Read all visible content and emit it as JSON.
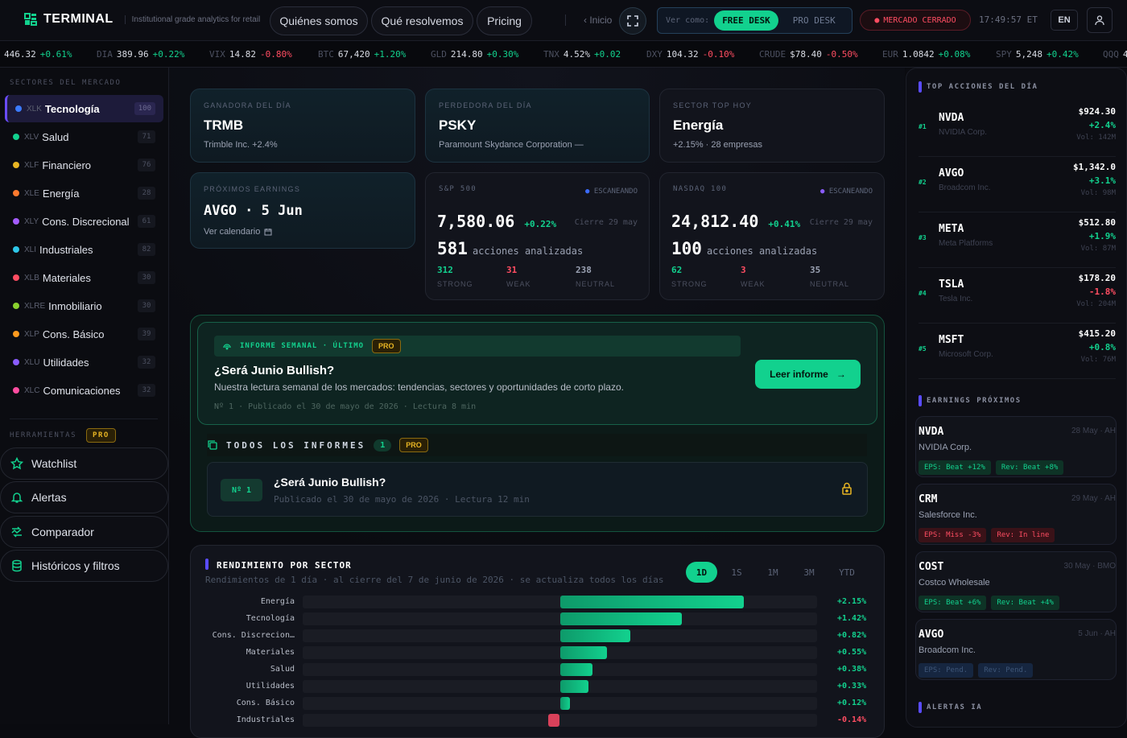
{
  "brand": {
    "name": "TERMINAL",
    "tagline": "Institutional grade analytics for retail"
  },
  "nav": {
    "items": [
      "Quiénes somos",
      "Qué resolvemos",
      "Pricing"
    ],
    "home": "Inicio"
  },
  "viewas": {
    "label": "Ver como:",
    "free": "FREE DESK",
    "pro": "PRO DESK"
  },
  "market_status": "MERCADO CERRADO",
  "clock": "17:49:57 ET",
  "lang": "EN",
  "ticker": [
    {
      "sym": "",
      "val": "446.32",
      "chg": "+0.61%",
      "dir": "up"
    },
    {
      "sym": "DIA",
      "val": "389.96",
      "chg": "+0.22%",
      "dir": "up"
    },
    {
      "sym": "VIX",
      "val": "14.82",
      "chg": "-0.80%",
      "dir": "dn"
    },
    {
      "sym": "BTC",
      "val": "67,420",
      "chg": "+1.20%",
      "dir": "up"
    },
    {
      "sym": "GLD",
      "val": "214.80",
      "chg": "+0.30%",
      "dir": "up"
    },
    {
      "sym": "TNX",
      "val": "4.52%",
      "chg": "+0.02",
      "dir": "up"
    },
    {
      "sym": "DXY",
      "val": "104.32",
      "chg": "-0.10%",
      "dir": "dn"
    },
    {
      "sym": "CRUDE",
      "val": "$78.40",
      "chg": "-0.50%",
      "dir": "dn"
    },
    {
      "sym": "EUR",
      "val": "1.0842",
      "chg": "+0.08%",
      "dir": "up"
    },
    {
      "sym": "SPY",
      "val": "5,248",
      "chg": "+0.42%",
      "dir": "up"
    },
    {
      "sym": "QQQ",
      "val": "4",
      "chg": "",
      "dir": "up"
    }
  ],
  "sidebar": {
    "sectors_title": "SECTORES DEL MERCADO",
    "sectors": [
      {
        "tk": "XLK",
        "name": "Tecnología",
        "count": "100",
        "color": "#3b7bff"
      },
      {
        "tk": "XLV",
        "name": "Salud",
        "count": "71",
        "color": "#12d18e"
      },
      {
        "tk": "XLF",
        "name": "Financiero",
        "count": "76",
        "color": "#e8b523"
      },
      {
        "tk": "XLE",
        "name": "Energía",
        "count": "28",
        "color": "#ff7a2e"
      },
      {
        "tk": "XLY",
        "name": "Cons. Discrecional",
        "count": "61",
        "color": "#a45cff"
      },
      {
        "tk": "XLI",
        "name": "Industriales",
        "count": "82",
        "color": "#2ec7e8"
      },
      {
        "tk": "XLB",
        "name": "Materiales",
        "count": "30",
        "color": "#ff4d62"
      },
      {
        "tk": "XLRE",
        "name": "Inmobiliario",
        "count": "30",
        "color": "#8ad12e"
      },
      {
        "tk": "XLP",
        "name": "Cons. Básico",
        "count": "39",
        "color": "#ff9a1e"
      },
      {
        "tk": "XLU",
        "name": "Utilidades",
        "count": "32",
        "color": "#8a5cff"
      },
      {
        "tk": "XLC",
        "name": "Comunicaciones",
        "count": "32",
        "color": "#ff4da0"
      }
    ],
    "tools_title": "HERRAMIENTAS",
    "pro": "PRO",
    "tools": [
      "Watchlist",
      "Alertas",
      "Comparador",
      "Históricos y filtros"
    ]
  },
  "cards": {
    "gainer": {
      "label": "GANADORA DEL DÍA",
      "ticker": "TRMB",
      "sub": "Trimble Inc. +2.4%"
    },
    "loser": {
      "label": "PERDEDORA DEL DÍA",
      "ticker": "PSKY",
      "sub": "Paramount Skydance Corporation —"
    },
    "sector": {
      "label": "SECTOR TOP HOY",
      "name": "Energía",
      "sub": "+2.15% · 28 empresas"
    },
    "earnings": {
      "label": "PRÓXIMOS EARNINGS",
      "value": "AVGO · 5 Jun",
      "link": "Ver calendario"
    },
    "sp500": {
      "label": "S&P 500",
      "scan": "ESCANEANDO",
      "value": "7,580.06",
      "chg": "+0.22%",
      "close": "Cierre 29 may",
      "count": "581",
      "count_label": "acciones analizadas",
      "strong": "312",
      "weak": "31",
      "neutral": "238"
    },
    "nasdaq": {
      "label": "NASDAQ 100",
      "scan": "ESCANEANDO",
      "value": "24,812.40",
      "chg": "+0.41%",
      "close": "Cierre 29 may",
      "count": "100",
      "count_label": "acciones analizadas",
      "strong": "62",
      "weak": "3",
      "neutral": "35"
    },
    "labels": {
      "strong": "STRONG",
      "weak": "WEAK",
      "neutral": "NEUTRAL"
    }
  },
  "report": {
    "bar_title": "INFORME SEMANAL · ÚLTIMO",
    "pro": "PRO",
    "title": "¿Será Junio Bullish?",
    "desc": "Nuestra lectura semanal de los mercados: tendencias, sectores y oportunidades de corto plazo.",
    "meta": "Nº 1 · Publicado el 30 de mayo de 2026 · Lectura 8 min",
    "button": "Leer informe",
    "all_title": "TODOS LOS INFORMES",
    "all_count": "1",
    "item": {
      "badge": "Nº 1",
      "title": "¿Será Junio Bullish?",
      "meta": "Publicado el 30 de mayo de 2026 · Lectura 12 min"
    }
  },
  "perf": {
    "title": "RENDIMIENTO POR SECTOR",
    "sub": "Rendimientos de 1 día · al cierre del 7 de junio de 2026 · se actualiza todos los días",
    "periods": [
      "1D",
      "1S",
      "1M",
      "3M",
      "YTD"
    ],
    "active": "1D"
  },
  "chart_data": {
    "type": "bar",
    "categories": [
      "Energía",
      "Tecnología",
      "Cons. Discrecion…",
      "Materiales",
      "Salud",
      "Utilidades",
      "Cons. Básico",
      "Industriales"
    ],
    "values": [
      2.15,
      1.42,
      0.82,
      0.55,
      0.38,
      0.33,
      0.12,
      -0.14
    ],
    "labels": [
      "+2.15%",
      "+1.42%",
      "+0.82%",
      "+0.55%",
      "+0.38%",
      "+0.33%",
      "+0.12%",
      "-0.14%"
    ],
    "xlim": [
      -3,
      3
    ]
  },
  "right": {
    "top_title": "TOP ACCIONES DEL DÍA",
    "stocks": [
      {
        "rank": "#1",
        "tk": "NVDA",
        "co": "NVIDIA Corp.",
        "price": "$924.30",
        "chg": "+2.4%",
        "dir": "up",
        "vol": "Vol: 142M"
      },
      {
        "rank": "#2",
        "tk": "AVGO",
        "co": "Broadcom Inc.",
        "price": "$1,342.0",
        "chg": "+3.1%",
        "dir": "up",
        "vol": "Vol: 98M"
      },
      {
        "rank": "#3",
        "tk": "META",
        "co": "Meta Platforms",
        "price": "$512.80",
        "chg": "+1.9%",
        "dir": "up",
        "vol": "Vol: 87M"
      },
      {
        "rank": "#4",
        "tk": "TSLA",
        "co": "Tesla Inc.",
        "price": "$178.20",
        "chg": "-1.8%",
        "dir": "dn",
        "vol": "Vol: 204M"
      },
      {
        "rank": "#5",
        "tk": "MSFT",
        "co": "Microsoft Corp.",
        "price": "$415.20",
        "chg": "+0.8%",
        "dir": "up",
        "vol": "Vol: 76M"
      }
    ],
    "earn_title": "EARNINGS PRÓXIMOS",
    "earnings": [
      {
        "tk": "NVDA",
        "date": "28 May · AH",
        "co": "NVIDIA Corp.",
        "eps": "EPS: Beat +12%",
        "eps_c": "g",
        "rev": "Rev: Beat +8%",
        "rev_c": "g"
      },
      {
        "tk": "CRM",
        "date": "29 May · AH",
        "co": "Salesforce Inc.",
        "eps": "EPS: Miss -3%",
        "eps_c": "r",
        "rev": "Rev: In line",
        "rev_c": "r"
      },
      {
        "tk": "COST",
        "date": "30 May · BMO",
        "co": "Costco Wholesale",
        "eps": "EPS: Beat +6%",
        "eps_c": "g",
        "rev": "Rev: Beat +4%",
        "rev_c": "g"
      },
      {
        "tk": "AVGO",
        "date": "5 Jun · AH",
        "co": "Broadcom Inc.",
        "eps": "EPS: Pend.",
        "eps_c": "n",
        "rev": "Rev: Pend.",
        "rev_c": "n"
      }
    ],
    "alerts_title": "ALERTAS IA"
  }
}
